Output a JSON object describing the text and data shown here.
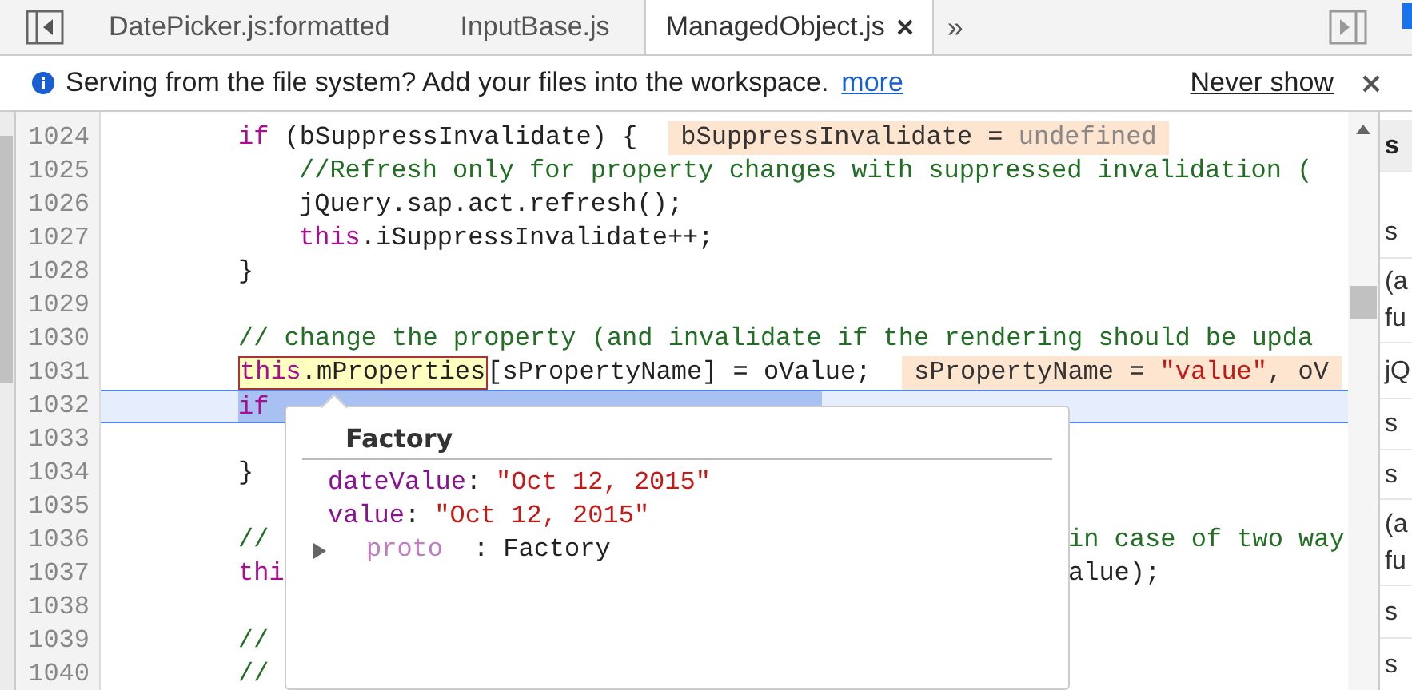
{
  "tabs": [
    {
      "label": "DatePicker.js:formatted",
      "selected": false
    },
    {
      "label": "InputBase.js",
      "selected": false
    },
    {
      "label": "ManagedObject.js",
      "selected": true
    }
  ],
  "tab_overflow": "»",
  "infobar": {
    "message": "Serving from the file system? Add your files into the workspace.",
    "link": "more",
    "action": "Never show"
  },
  "lines": [
    {
      "number": "1024",
      "kind": "outer",
      "tokens": [
        {
          "text": "if",
          "kind": "keyword"
        },
        {
          "text": " (bSuppressInvalidate) {",
          "kind": "plain"
        }
      ],
      "annotation": [
        {
          "text": "bSuppressInvalidate = ",
          "kind": "name"
        },
        {
          "text": "undefined",
          "kind": "undefined"
        }
      ]
    },
    {
      "number": "1025",
      "kind": "inner",
      "tokens": [
        {
          "text": "//Refresh only for property changes with suppressed invalidation (",
          "kind": "comment"
        }
      ]
    },
    {
      "number": "1026",
      "kind": "inner",
      "tokens": [
        {
          "text": "jQuery.sap.act.refresh();",
          "kind": "plain"
        }
      ]
    },
    {
      "number": "1027",
      "kind": "inner",
      "tokens": [
        {
          "text": "this",
          "kind": "keyword"
        },
        {
          "text": ".iSuppressInvalidate++;",
          "kind": "plain"
        }
      ]
    },
    {
      "number": "1028",
      "kind": "outer",
      "tokens": [
        {
          "text": "}",
          "kind": "plain"
        }
      ]
    },
    {
      "number": "1029"
    },
    {
      "number": "1030",
      "kind": "outer",
      "tokens": [
        {
          "text": "// change the property (and invalidate if the rendering should be upda",
          "kind": "comment"
        }
      ]
    },
    {
      "number": "1031",
      "kind": "outer",
      "tokens": [
        {
          "text": "this",
          "kind": "keyword",
          "hovered": true
        },
        {
          "text": ".mProperties",
          "kind": "plain",
          "hovered": true
        },
        {
          "text": "[sPropertyName] = oValue;",
          "kind": "plain"
        }
      ],
      "annotation": [
        {
          "text": "sPropertyName = ",
          "kind": "name"
        },
        {
          "text": "\"value\"",
          "kind": "string"
        },
        {
          "text": ", oV",
          "kind": "name"
        }
      ]
    },
    {
      "number": "1032",
      "kind": "outer",
      "current": true,
      "tokens": [
        {
          "text": "if",
          "kind": "keyword"
        }
      ]
    },
    {
      "number": "1033"
    },
    {
      "number": "1034",
      "kind": "outer",
      "tokens": [
        {
          "text": "}",
          "kind": "plain"
        }
      ]
    },
    {
      "number": "1035"
    },
    {
      "number": "1036",
      "kind": "outer",
      "tokens": [
        {
          "text": "//",
          "kind": "comment"
        }
      ],
      "after_popup": [
        {
          "text": "in case of two way",
          "kind": "comment"
        }
      ]
    },
    {
      "number": "1037",
      "kind": "outer",
      "tokens": [
        {
          "text": "thi",
          "kind": "keyword"
        }
      ],
      "after_popup": [
        {
          "text": "alue);",
          "kind": "plain"
        }
      ]
    },
    {
      "number": "1038"
    },
    {
      "number": "1039",
      "kind": "outer",
      "tokens": [
        {
          "text": "//",
          "kind": "comment"
        }
      ]
    },
    {
      "number": "1040",
      "kind": "outer",
      "tokens": [
        {
          "text": "//",
          "kind": "comment"
        }
      ]
    }
  ],
  "popup": {
    "title": "Factory",
    "properties": [
      {
        "name": "dateValue",
        "separator": ":",
        "value": "\"Oct 12, 2015\"",
        "kind": "string"
      },
      {
        "name": "value",
        "separator": ":",
        "value": "\"Oct 12, 2015\"",
        "kind": "string"
      },
      {
        "name": "proto",
        "separator": ":",
        "value": "Factory",
        "kind": "object",
        "expanded": false
      }
    ]
  },
  "side_panel": [
    {
      "kind": "header",
      "lines": [
        "s"
      ]
    },
    {
      "kind": "row",
      "lines": [
        "s"
      ]
    },
    {
      "kind": "row",
      "lines": [
        "(a",
        "fu"
      ]
    },
    {
      "kind": "row",
      "lines": [
        "jQ"
      ]
    },
    {
      "kind": "row",
      "lines": [
        "s"
      ]
    },
    {
      "kind": "row",
      "lines": [
        "s"
      ]
    },
    {
      "kind": "row",
      "lines": [
        "(a",
        "fu"
      ]
    },
    {
      "kind": "row",
      "lines": [
        "s"
      ]
    },
    {
      "kind": "row",
      "lines": [
        "s"
      ]
    }
  ]
}
